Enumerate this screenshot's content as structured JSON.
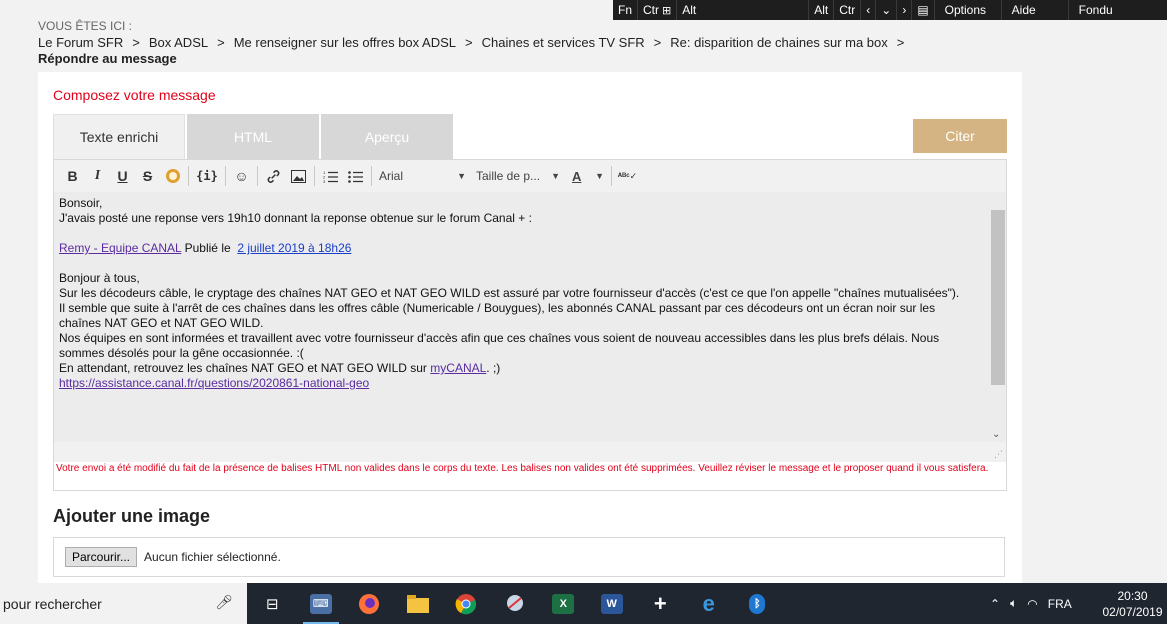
{
  "breadcrumb": {
    "label": "VOUS ÊTES ICI :",
    "items": [
      "Le Forum SFR",
      "Box ADSL",
      "Me renseigner sur les offres box ADSL",
      "Chaines et services TV SFR",
      "Re: disparition de chaines sur ma box"
    ],
    "separator": ">",
    "current": "Répondre au message"
  },
  "osk": {
    "keys": [
      "Fn",
      "Ctr",
      "Alt",
      "Alt",
      "Ctr",
      "Options",
      "Aide",
      "Fondu"
    ]
  },
  "compose": {
    "title": "Composez votre message",
    "tabs": [
      "Texte enrichi",
      "HTML",
      "Aperçu"
    ],
    "quote_button": "Citer"
  },
  "toolbar": {
    "font": "Arial",
    "font_size": "Taille de p...",
    "color_letter": "A"
  },
  "message": {
    "line1": "Bonsoir,",
    "line2": "J'avais posté une reponse vers 19h10 donnant la reponse obtenue sur le forum Canal + :",
    "author_link": "Remy - Equipe CANAL",
    "published": "Publié le",
    "date_link": "2 juillet 2019 à 18h26",
    "greeting": "Bonjour à tous,",
    "para1": "Sur les décodeurs câble, le cryptage des chaînes NAT GEO et NAT GEO WILD est assuré par votre fournisseur d'accès (c'est ce que l'on appelle \"chaînes mutualisées\").",
    "para2a": "Il semble que suite à l'arrêt de ces chaînes dans les offres câble (Numericable / Bouygues), les abonnés CANAL passant par ces décodeurs ont un écran noir sur les",
    "para2b": "chaînes NAT GEO et NAT GEO WILD.",
    "para3a": "Nos équipes en sont informées et travaillent avec votre fournisseur d'accès afin que ces chaînes vous soient de nouveau accessibles dans les plus brefs délais. Nous",
    "para3b": "sommes désolés pour la gêne occasionnée. :(",
    "para4_prefix": "En attendant, retrouvez les chaînes NAT GEO et NAT GEO WILD sur",
    "mycanal_link": "myCANAL",
    "para4_suffix": ". ;)",
    "url_link": "https://assistance.canal.fr/questions/2020861-national-geo"
  },
  "warning": "Votre envoi a été modifié du fait de la présence de balises HTML non valides dans le corps du texte. Les balises non valides ont été supprimées. Veuillez réviser le message et le proposer quand il vous satisfera.",
  "image_section": {
    "title": "Ajouter une image",
    "browse_button": "Parcourir...",
    "no_file": "Aucun fichier sélectionné."
  },
  "taskbar": {
    "search_text": "pour rechercher",
    "language": "FRA",
    "time": "20:30",
    "date": "02/07/2019"
  }
}
